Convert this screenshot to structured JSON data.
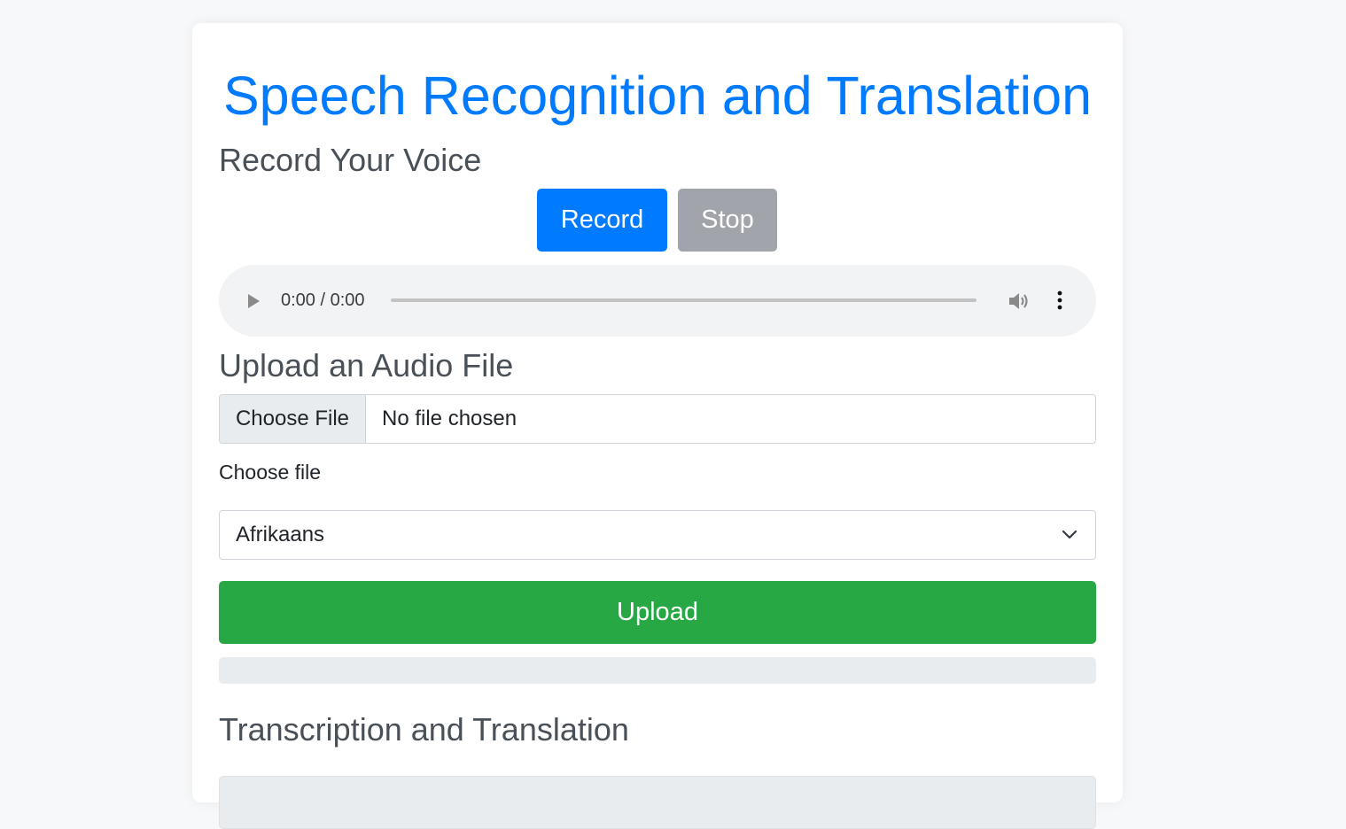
{
  "page": {
    "title": "Speech Recognition and Translation"
  },
  "record_section": {
    "heading": "Record Your Voice",
    "record_label": "Record",
    "stop_label": "Stop"
  },
  "audio_player": {
    "time_display": "0:00 / 0:00",
    "progress": 0,
    "icons": [
      "play-icon",
      "volume-icon",
      "more-options-icon"
    ]
  },
  "upload_section": {
    "heading": "Upload an Audio File",
    "file_button_label": "Choose File",
    "file_status": "No file chosen",
    "file_label": "Choose file",
    "language_selected": "Afrikaans",
    "upload_label": "Upload",
    "upload_progress": 0
  },
  "results_section": {
    "heading": "Transcription and Translation"
  },
  "colors": {
    "title": "#007bff",
    "record_button": "#007bff",
    "stop_button": "#a1a5ab",
    "upload_button": "#28a745",
    "progress_track": "#e9ecef"
  }
}
